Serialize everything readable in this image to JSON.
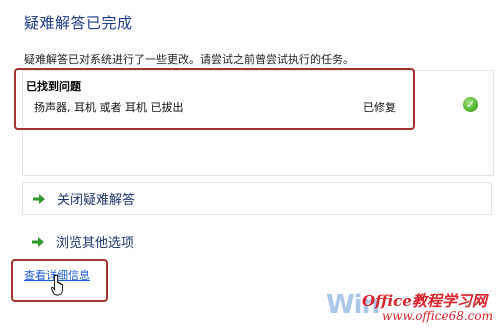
{
  "title": "疑难解答已完成",
  "description": "疑难解答已对系统进行了一些更改。请尝试之前曾尝试执行的任务。",
  "problems": {
    "header": "已找到问题",
    "items": [
      {
        "text": "扬声器, 耳机 或者 耳机 已拔出",
        "status": "已修复",
        "status_icon": "check-icon"
      }
    ]
  },
  "faint_watermark": "",
  "actions": [
    {
      "label": "关闭疑难解答",
      "icon": "arrow-right-icon"
    },
    {
      "label": "浏览其他选项",
      "icon": "arrow-right-icon"
    }
  ],
  "details_link": "查看详细信息",
  "watermark": {
    "win_text": "Win",
    "brand": "Office教程学习网",
    "url": "www.office68.com"
  },
  "colors": {
    "title": "#1e3b8a",
    "link": "#1a5bd6",
    "annotation": "#a8322f",
    "success": "#55b82e",
    "watermark": "#d9232a"
  }
}
